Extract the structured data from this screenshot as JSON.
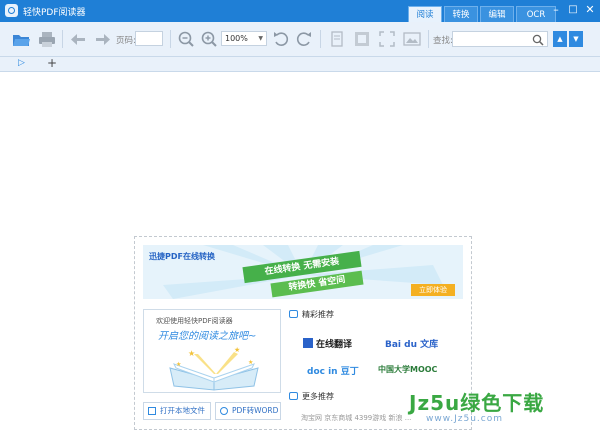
{
  "window": {
    "title": "轻快PDF阅读器"
  },
  "tabs": [
    {
      "label": "阅读",
      "active": true
    },
    {
      "label": "转换",
      "active": false
    },
    {
      "label": "编辑",
      "active": false
    },
    {
      "label": "OCR",
      "active": false
    }
  ],
  "window_controls": {
    "minimize": "–",
    "maximize": "□",
    "close": "✕"
  },
  "toolbar": {
    "page_label": "页码:",
    "zoom_value": "100%",
    "search_label": "查找:"
  },
  "tabstrip": {
    "add": "+"
  },
  "promo": {
    "banner_title": "迅捷PDF在线转换",
    "ribbon_1": "在线转换 无需安装",
    "ribbon_2": "转换快 省空间",
    "banner_button": "立即体验",
    "welcome_sub": "欢迎使用轻快PDF阅读器",
    "welcome_head": "开启您的阅读之旅吧~",
    "open_local": "打开本地文件",
    "pdf_to_word": "PDF转WORD",
    "recommend_title": "精彩推荐",
    "more_title": "更多推荐",
    "logos": [
      "在线翻译",
      "Bai du 文库",
      "doc in 豆丁",
      "中国大学MOOC"
    ],
    "footer_links": "淘宝网 京东商城 4399游戏 新浪 ..."
  },
  "watermark": {
    "main": "Jz5u绿色下载",
    "sub": "www.Jz5u.com"
  },
  "colors": {
    "accent": "#1f7fd6",
    "toolbar_bg": "#e9f1fa",
    "green": "#46b04a",
    "orange": "#f4b022"
  }
}
